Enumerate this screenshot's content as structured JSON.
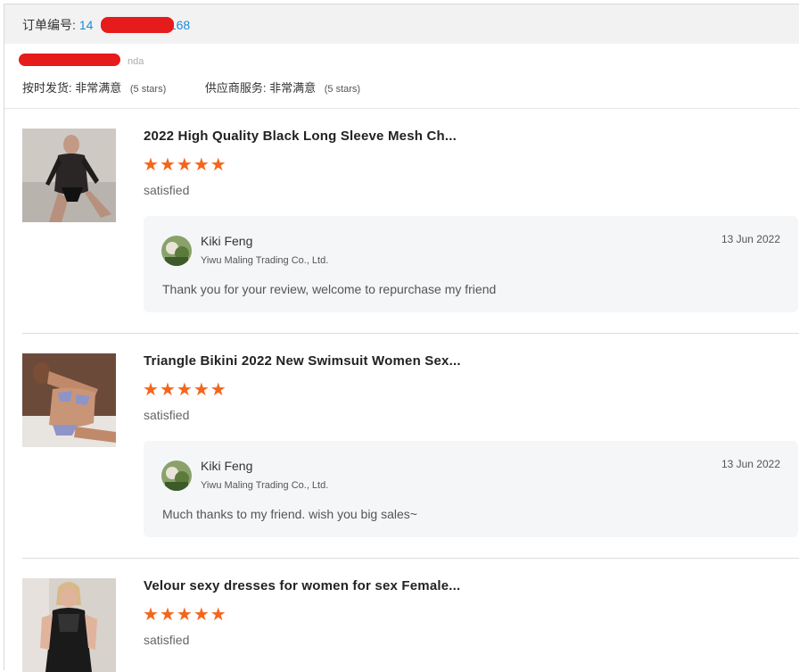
{
  "header": {
    "order_label": "订单编号:",
    "order_number_prefix": "14",
    "order_number_suffix": "022168",
    "buyer_suffix": "nda"
  },
  "ratings": {
    "shipping_label": "按时发货:",
    "shipping_value": "非常满意",
    "shipping_stars": "(5 stars)",
    "service_label": "供应商服务:",
    "service_value": "非常满意",
    "service_stars": "(5 stars)"
  },
  "items": [
    {
      "title": "2022 High Quality Black Long Sleeve Mesh Ch...",
      "rating": 5,
      "verdict": "satisfied",
      "reply": {
        "name": "Kiki Feng",
        "company": "Yiwu Maling Trading Co., Ltd.",
        "date": "13 Jun 2022",
        "text": "Thank you for your review, welcome to repurchase my friend"
      }
    },
    {
      "title": "Triangle Bikini 2022 New Swimsuit Women Sex...",
      "rating": 5,
      "verdict": "satisfied",
      "reply": {
        "name": "Kiki Feng",
        "company": "Yiwu Maling Trading Co., Ltd.",
        "date": "13 Jun 2022",
        "text": "Much thanks to my friend. wish you big sales~"
      }
    },
    {
      "title": "Velour sexy dresses for women for sex Female...",
      "rating": 5,
      "verdict": "satisfied"
    }
  ],
  "colors": {
    "star": "#f3661c",
    "link": "#1a8cd8",
    "redaction": "#e61b1b",
    "reply_bg": "#f4f6f8"
  },
  "icons": {
    "star": "star-icon"
  }
}
